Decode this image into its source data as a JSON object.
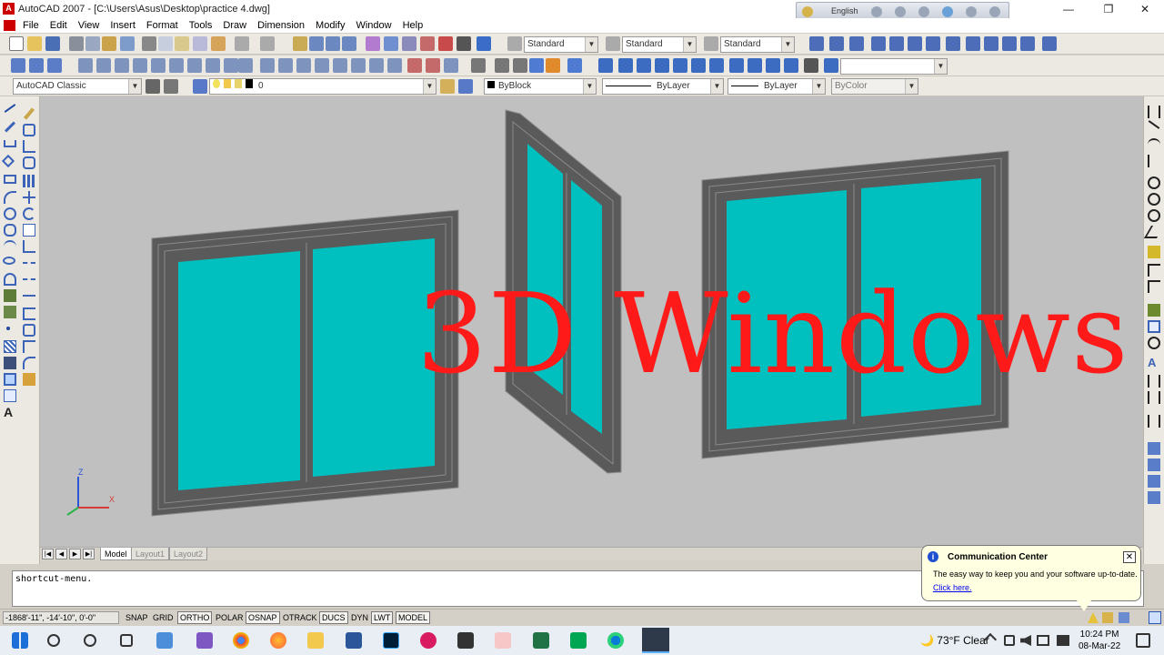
{
  "window": {
    "title": "AutoCAD 2007 - [C:\\Users\\Asus\\Desktop\\practice 4.dwg]",
    "app_icon_text": "A",
    "language": "English",
    "min": "—",
    "restore": "❐",
    "close": "✕"
  },
  "menubar": [
    "File",
    "Edit",
    "View",
    "Insert",
    "Format",
    "Tools",
    "Draw",
    "Dimension",
    "Modify",
    "Window",
    "Help"
  ],
  "toolbar_styles": {
    "text_style": "Standard",
    "dim_style": "Standard",
    "table_style": "Standard",
    "workspace": "AutoCAD Classic",
    "layer": "0",
    "color": "ByBlock",
    "linetype": "ByLayer",
    "lineweight": "ByLayer",
    "plotstyle": "ByColor",
    "dropdown_arrow": "▼"
  },
  "overlay_title": "3D Windows",
  "colors": {
    "frame": "#5a5a5a",
    "frame_light": "#8a8a8a",
    "glass": "#00bfbf",
    "title_red": "#ff1a1a",
    "canvas": "#c0c0c0"
  },
  "ucs": {
    "z": "Z",
    "x": "X"
  },
  "layout_tabs": {
    "nav": [
      "|◀",
      "◀",
      "▶",
      "▶|"
    ],
    "tabs": [
      "Model",
      "Layout1",
      "Layout2"
    ]
  },
  "command_line": "shortcut-menu.",
  "status_bar": {
    "coords": "-1868'-11\", -14'-10\", 0'-0\"",
    "toggles": [
      "SNAP",
      "GRID",
      "ORTHO",
      "POLAR",
      "OSNAP",
      "OTRACK",
      "DUCS",
      "DYN",
      "LWT",
      "MODEL"
    ]
  },
  "communication_center": {
    "icon": "i",
    "title": "Communication Center",
    "body": "The easy way to keep you and your software up-to-date.",
    "link": "Click here.",
    "close": "✕"
  },
  "taskbar": {
    "weather": "🌙  73°F  Clear",
    "time": "10:24 PM",
    "date": "08-Mar-22"
  }
}
